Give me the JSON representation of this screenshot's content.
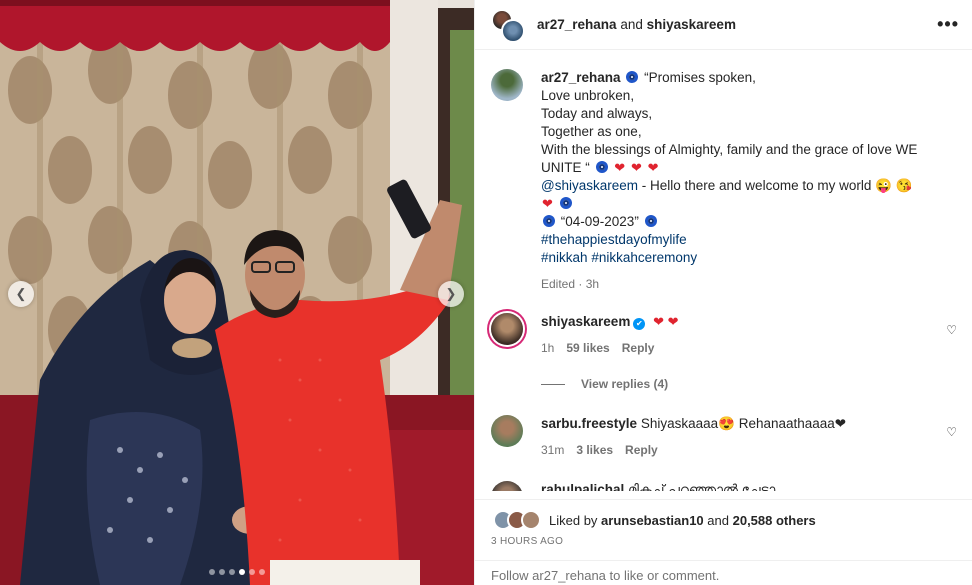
{
  "header": {
    "user1": "ar27_rehana",
    "and": "and",
    "user2": "shiyaskareem",
    "more": "•••"
  },
  "caption": {
    "username": "ar27_rehana",
    "line1": "“Promises spoken,",
    "line2": "Love unbroken,",
    "line3": "Today and always,",
    "line4": "Together as one,",
    "line5": "With the blessings of Almighty, family and the grace of love WE",
    "line6": "UNITE “",
    "mention": "@shiyaskareem",
    "mention_text": " - Hello there and welcome to my world 😜 😘",
    "date": "“04-09-2023”",
    "hashtag1": "#thehappiestdayofmylife",
    "hashtag2": "#nikkah",
    "hashtag3": "#nikkahceremony",
    "edited": "Edited · 3h",
    "heart": "❤",
    "icons": [
      "evil-eye-icon",
      "heart-icon"
    ]
  },
  "comments": [
    {
      "username": "shiyaskareem",
      "verified": true,
      "text": "❤ ❤",
      "time": "1h",
      "likes": "59 likes",
      "reply": "Reply"
    },
    {
      "username": "sarbu.freestyle",
      "text": "Shiyaskaaaa😍 Rehanaathaaaa❤",
      "time": "31m",
      "likes": "3 likes",
      "reply": "Reply"
    },
    {
      "username": "rahulpalichal",
      "text": "മികച്ച് പറഞ്ഞാൽ ചേട്ടാ"
    }
  ],
  "view_replies": "View replies (4)",
  "likes": {
    "prefix": "Liked by",
    "user": "arunsebastian10",
    "connector": "and",
    "others": "20,588 others"
  },
  "time_ago": "3 HOURS AGO",
  "follow_prompt": "Follow ar27_rehana to like or comment.",
  "carousel": {
    "total": 6,
    "active": 4
  },
  "colors": {
    "link": "#00376b",
    "heart": "#e0242f",
    "verified": "#0095f6",
    "muted": "#737373",
    "kurta": "#e8322b"
  }
}
